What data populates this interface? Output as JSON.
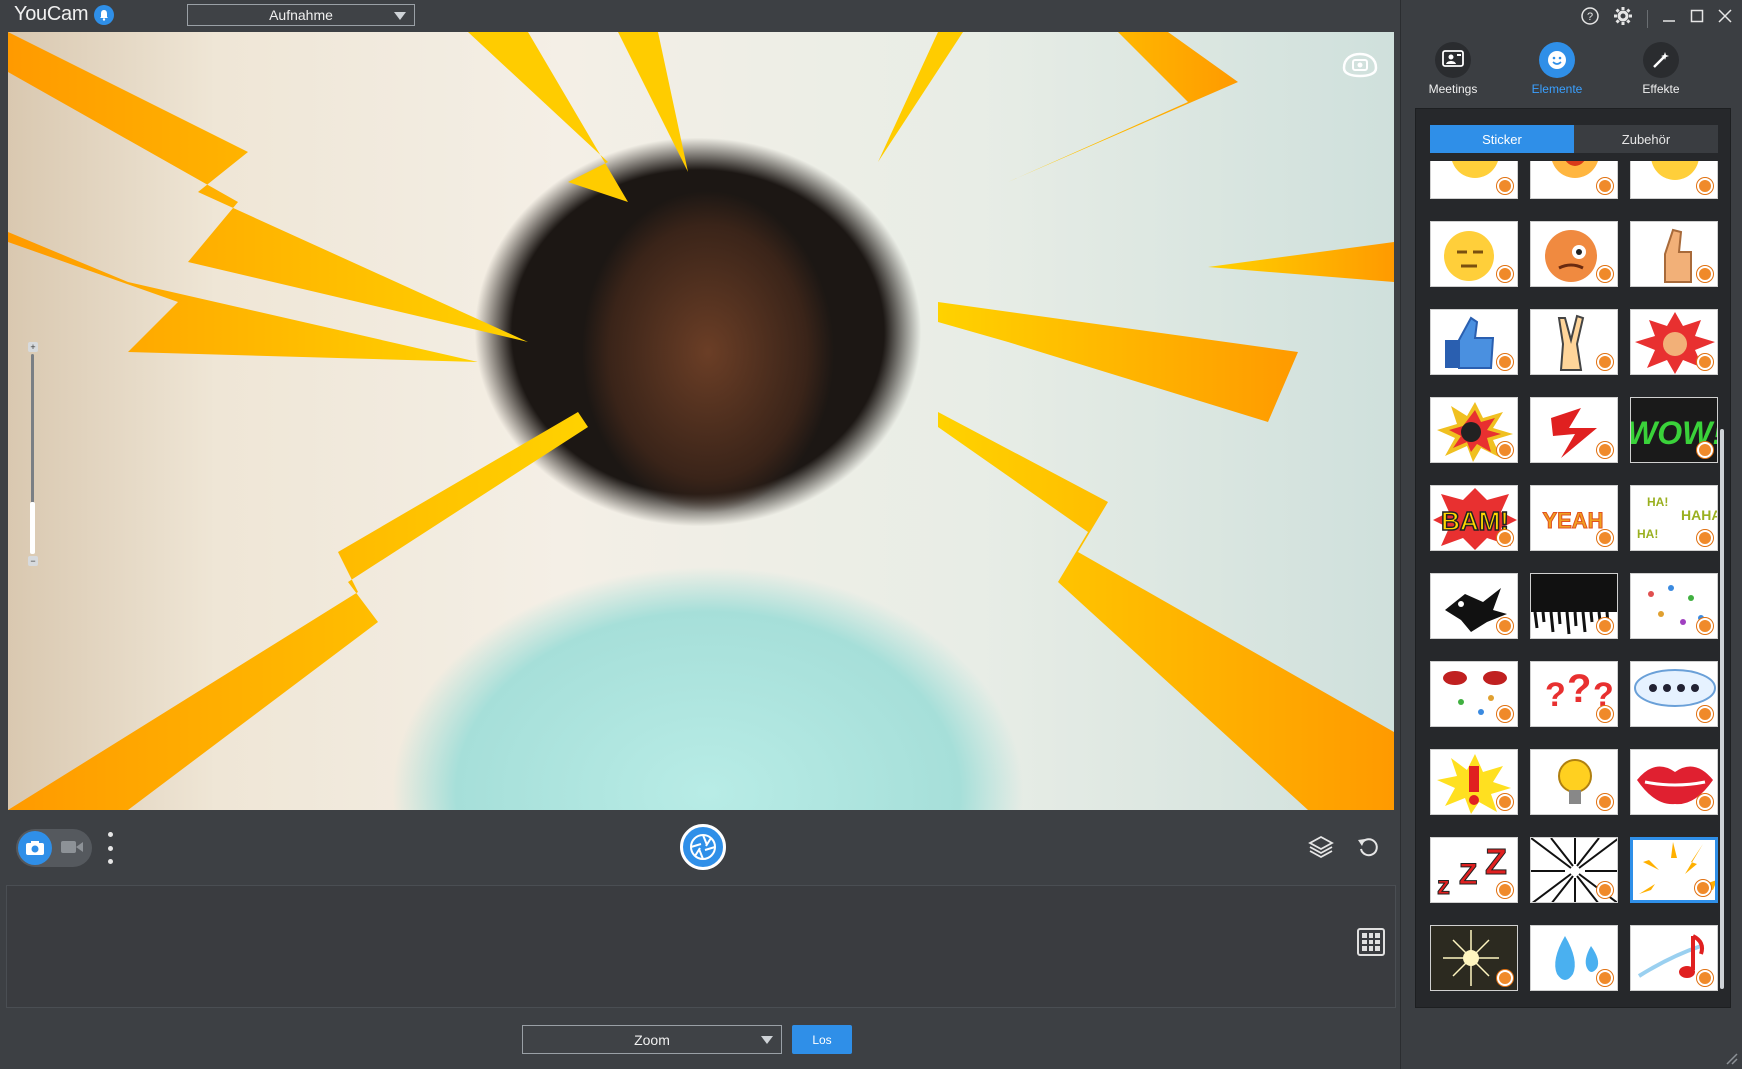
{
  "app": {
    "title": "YouCam"
  },
  "header": {
    "mode_value": "Aufnahme"
  },
  "side_tabs": [
    {
      "label": "Meetings",
      "icon": "meetings-icon"
    },
    {
      "label": "Elemente",
      "icon": "stickers-face-icon"
    },
    {
      "label": "Effekte",
      "icon": "magic-wand-icon"
    }
  ],
  "subtabs": [
    {
      "label": "Sticker"
    },
    {
      "label": "Zubehör"
    }
  ],
  "bottom": {
    "zoom_value": "Zoom",
    "go_label": "Los"
  },
  "colors": {
    "accent": "#2f8fe8",
    "badge": "#f08a2a"
  },
  "stickers": [
    "emoji-glasses",
    "emoji-red-face",
    "emoji-squint",
    "emoji-meh",
    "emoji-angry",
    "thumb-up-hand",
    "thumbs-up-blue",
    "peace-hand",
    "punch-burst",
    "bomb-burst",
    "lightning-red",
    "wow-text",
    "bam-text",
    "yeah-text",
    "haha-text",
    "black-bird",
    "black-streaks",
    "music-notes-dots",
    "eyes-dots",
    "question-marks",
    "speech-dots",
    "exclamation-burst",
    "light-bulb",
    "red-lips",
    "zzz-text",
    "speed-lines",
    "lightning-frame",
    "sparkle-star",
    "water-drops",
    "music-note-red"
  ]
}
